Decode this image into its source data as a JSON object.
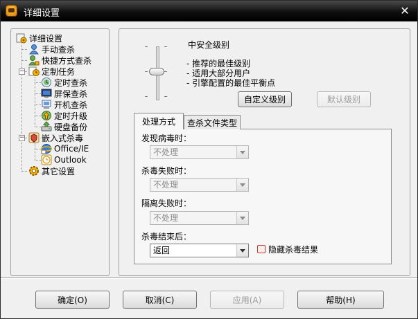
{
  "window": {
    "title": "详细设置",
    "close_glyph": "✕"
  },
  "tree": {
    "root": "详细设置",
    "manual_scan": "手动查杀",
    "quick_scan": "快捷方式查杀",
    "scheduled": "定制任务",
    "scheduled_children": [
      "定时查杀",
      "屏保查杀",
      "开机查杀",
      "定时升级",
      "硬盘备份"
    ],
    "embedded": "嵌入式杀毒",
    "embedded_children": [
      "Office/IE",
      "Outlook"
    ],
    "other": "其它设置"
  },
  "security": {
    "level_title": "中安全级别",
    "lines": [
      "- 推荐的最佳级别",
      "- 适用大部分用户",
      "- 引擎配置的最佳平衡点"
    ],
    "custom_button": "自定义级别",
    "default_button": "默认级别"
  },
  "tabs": {
    "active": "处理方式",
    "inactive": "查杀文件类型"
  },
  "form": {
    "virus_found_label": "发现病毒时：",
    "virus_found_value": "不处理",
    "kill_fail_label": "杀毒失败时：",
    "kill_fail_value": "不处理",
    "quarantine_fail_label": "隔离失败时：",
    "quarantine_fail_value": "不处理",
    "after_kill_label": "杀毒结束后：",
    "after_kill_value": "返回",
    "hide_results_label": "隐藏杀毒结果"
  },
  "footer": {
    "ok": "确定(O)",
    "cancel": "取消(C)",
    "apply": "应用(A)",
    "help": "帮助(H)"
  }
}
